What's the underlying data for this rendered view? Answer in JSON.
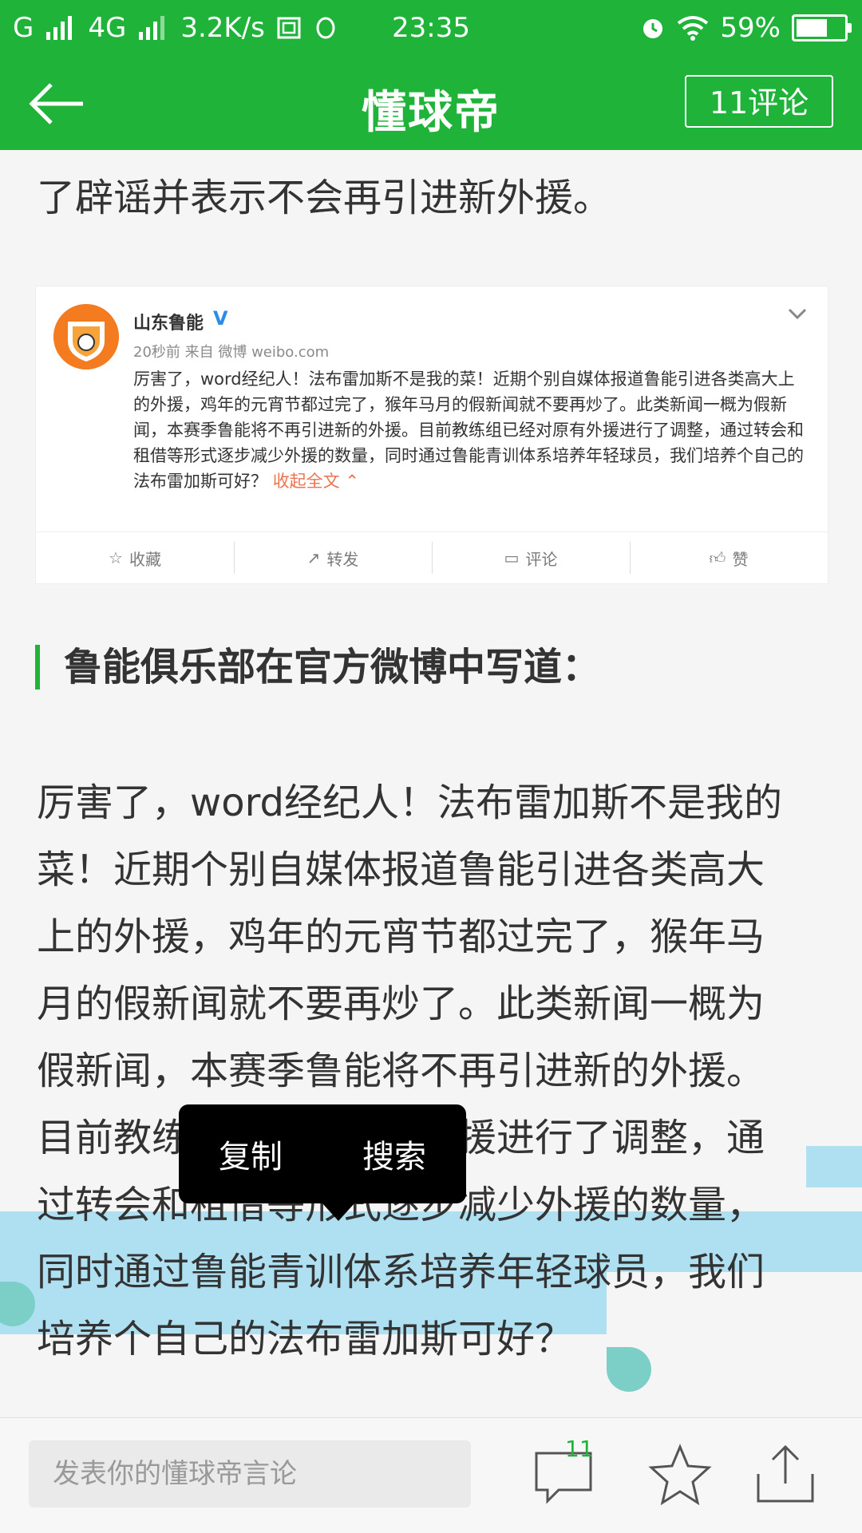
{
  "status_bar": {
    "carrier_left": "G",
    "network": "4G",
    "speed": "3.2K/s",
    "time": "23:35",
    "battery": "59%"
  },
  "header": {
    "title": "懂球帝",
    "comments_label": "11评论"
  },
  "content": {
    "intro_line": "了辟谣并表示不会再引进新外援。",
    "weibo": {
      "name": "山东鲁能",
      "v_badge": "V",
      "meta": "20秒前 来自 微博 weibo.com",
      "text": "厉害了，word经纪人！法布雷加斯不是我的菜！近期个别自媒体报道鲁能引进各类高大上的外援，鸡年的元宵节都过完了，猴年马月的假新闻就不要再炒了。此类新闻一概为假新闻，本赛季鲁能将不再引进新的外援。目前教练组已经对原有外援进行了调整，通过转会和租借等形式逐步减少外援的数量，同时通过鲁能青训体系培养年轻球员，我们培养个自己的法布雷加斯可好？",
      "collapse_label": "收起全文",
      "actions": [
        "收藏",
        "转发",
        "评论",
        "赞"
      ]
    },
    "section_heading": "鲁能俱乐部在官方微博中写道：",
    "body_lines": [
      "厉害了，word经纪人！法布雷加斯不是我的",
      "菜！近期个别自媒体报道鲁能引进各类高大",
      "上的外援，鸡年的元宵节都过完了，猴年马",
      "月的假新闻就不要再炒了。此类新闻一概为",
      "假新闻，本赛季鲁能将不再引进新的外援。",
      "目前教练组已经对原有外援进行了调整，通",
      "过转会和租借等形式逐步减少外援的数量，",
      "同时通过鲁能青训体系培养年轻球员，我们",
      "培养个自己的法布雷加斯可好？"
    ],
    "context_menu": [
      "复制",
      "搜索"
    ]
  },
  "bottom_bar": {
    "input_placeholder": "发表你的懂球帝言论",
    "comment_count": "11"
  },
  "colors": {
    "brand_green": "#1fb33a",
    "selection": "#aee0f2",
    "weibo_link": "#eb7350"
  }
}
